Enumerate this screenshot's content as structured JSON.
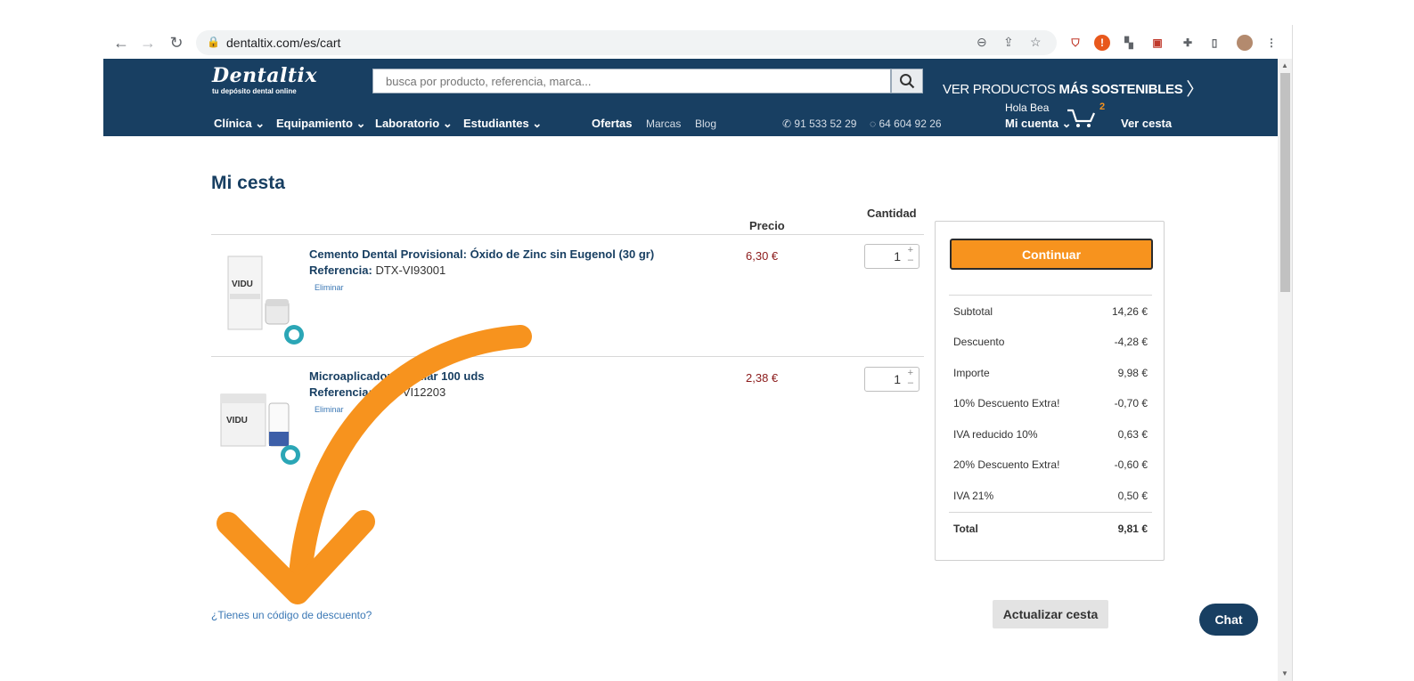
{
  "browser": {
    "url": "dentaltix.com/es/cart"
  },
  "site": {
    "logo": "Dentaltix",
    "logo_sub": "tu depósito dental online",
    "search_placeholder": "busca por producto, referencia, marca...",
    "sostenibles_pre": "VER PRODUCTOS ",
    "sostenibles_bold": "MÁS SOSTENIBLES",
    "menu": [
      "Clínica",
      "Equipamiento",
      "Laboratorio",
      "Estudiantes"
    ],
    "ofertas": "Ofertas",
    "marcas": "Marcas",
    "blog": "Blog",
    "phone1": "91 533 52 29",
    "phone2": "64 604 92 26",
    "hola": "Hola Bea",
    "mi_cuenta": "Mi cuenta",
    "cart_count": "2",
    "ver_cesta": "Ver cesta"
  },
  "cart": {
    "title": "Mi cesta",
    "col_precio": "Precio",
    "col_cantidad": "Cantidad",
    "ref_label": "Referencia:",
    "eliminar": "Eliminar",
    "items": [
      {
        "name": "Cemento Dental Provisional: Óxido de Zinc sin Eugenol (30 gr)",
        "ref": "DTX-VI93001",
        "price": "6,30 €",
        "qty": "1"
      },
      {
        "name": "Microaplicador Regular 100 uds",
        "ref": "DTX-VI12203",
        "price": "2,38 €",
        "qty": "1"
      }
    ],
    "discount_link": "¿Tienes un código de descuento?",
    "actualizar": "Actualizar cesta"
  },
  "summary": {
    "continuar": "Continuar",
    "rows": [
      {
        "label": "Subtotal",
        "value": "14,26 €"
      },
      {
        "label": "Descuento",
        "value": "-4,28 €"
      },
      {
        "label": "Importe",
        "value": "9,98 €"
      },
      {
        "label": "10% Descuento Extra!",
        "value": "-0,70 €"
      },
      {
        "label": "IVA reducido 10%",
        "value": "0,63 €"
      },
      {
        "label": "20% Descuento Extra!",
        "value": "-0,60 €"
      },
      {
        "label": "IVA 21%",
        "value": "0,50 €"
      }
    ],
    "total_label": "Total",
    "total_value": "9,81 €"
  },
  "chat": "Chat",
  "product_brand": "VIDU",
  "colors": {
    "header": "#183f62",
    "accent": "#f7931e",
    "price": "#8b1a1a",
    "link": "#3b78b5"
  }
}
